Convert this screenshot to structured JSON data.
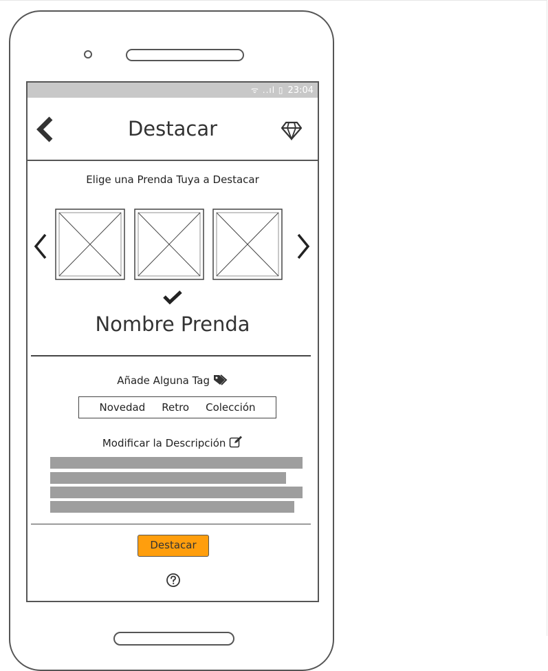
{
  "status_bar": {
    "signal_icons": "ᯤ ..ıl ▯",
    "time": "23:04"
  },
  "header": {
    "title": "Destacar",
    "back_icon": "chevron-left-icon",
    "right_icon": "diamond-icon"
  },
  "chooser": {
    "label": "Elige una Prenda Tuya a Destacar",
    "thumbnail_count": 3,
    "item_name": "Nombre Prenda"
  },
  "tags": {
    "label": "Añade Alguna Tag",
    "items": [
      "Novedad",
      "Retro",
      "Colección"
    ]
  },
  "description": {
    "label": "Modificar la Descripción"
  },
  "primary_button": {
    "label": "Destacar",
    "color": "#ff9e0d"
  },
  "help_icon": "question-circle-icon"
}
